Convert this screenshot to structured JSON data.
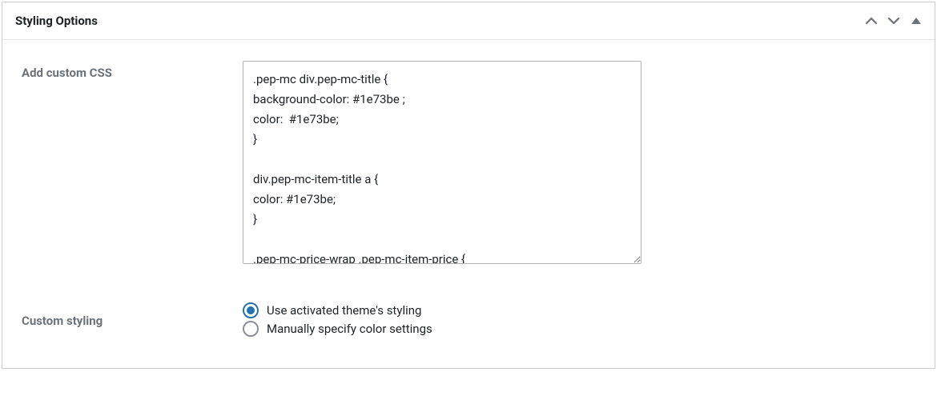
{
  "panel": {
    "title": "Styling Options"
  },
  "fields": {
    "customCss": {
      "label": "Add custom CSS",
      "value": ".pep-mc div.pep-mc-title {\nbackground-color: #1e73be ;\ncolor:  #1e73be;\n}\n\ndiv.pep-mc-item-title a {\ncolor: #1e73be;\n}\n\n.pep-mc-price-wrap .pep-mc-item-price {"
    },
    "customStyling": {
      "label": "Custom styling",
      "options": [
        {
          "label": "Use activated theme's styling",
          "checked": true
        },
        {
          "label": "Manually specify color settings",
          "checked": false
        }
      ]
    }
  }
}
